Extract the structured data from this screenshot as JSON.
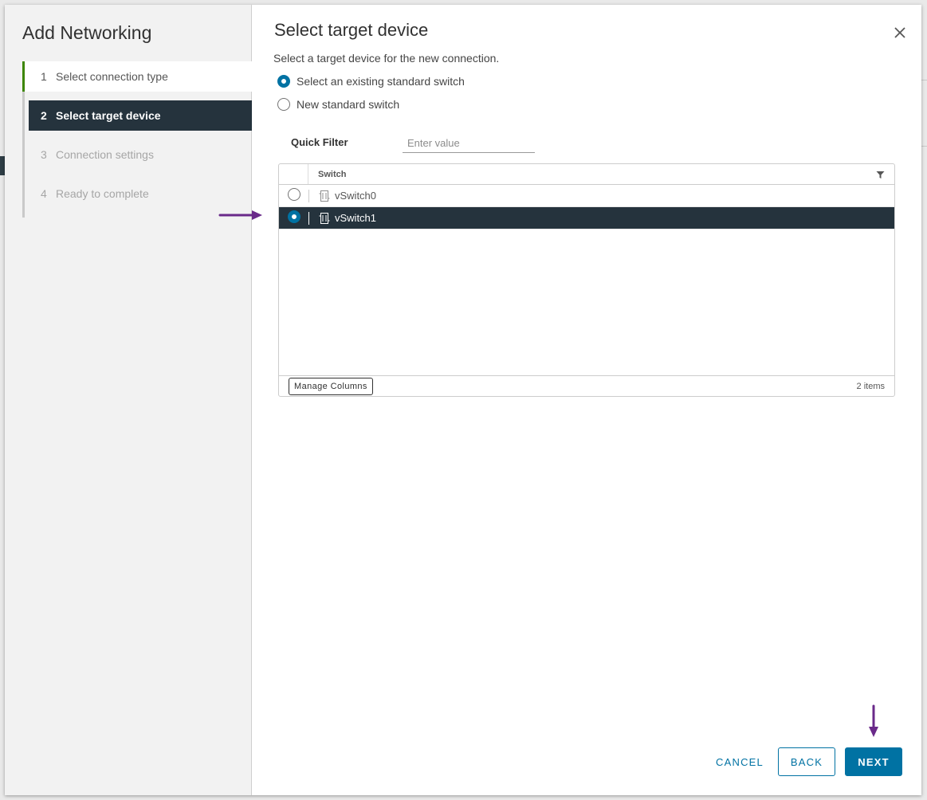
{
  "wizard": {
    "title": "Add Networking",
    "steps": [
      {
        "num": "1",
        "label": "Select connection type",
        "state": "done"
      },
      {
        "num": "2",
        "label": "Select target device",
        "state": "active"
      },
      {
        "num": "3",
        "label": "Connection settings",
        "state": "disabled"
      },
      {
        "num": "4",
        "label": "Ready to complete",
        "state": "disabled"
      }
    ]
  },
  "page": {
    "title": "Select target device",
    "description": "Select a target device for the new connection.",
    "options": [
      {
        "label": "Select an existing standard switch",
        "selected": true
      },
      {
        "label": "New standard switch",
        "selected": false
      }
    ]
  },
  "filter": {
    "label": "Quick Filter",
    "placeholder": "Enter value",
    "value": ""
  },
  "grid": {
    "column": "Switch",
    "rows": [
      {
        "name": "vSwitch0",
        "selected": false
      },
      {
        "name": "vSwitch1",
        "selected": true
      }
    ],
    "manage_columns": "Manage Columns",
    "count": "2 items"
  },
  "footer": {
    "cancel": "CANCEL",
    "back": "BACK",
    "next": "NEXT"
  },
  "colors": {
    "accent": "#0072a3",
    "nav_active_bg": "#25333d",
    "step_done": "#3c8500",
    "annotation": "#6a2a8a"
  }
}
